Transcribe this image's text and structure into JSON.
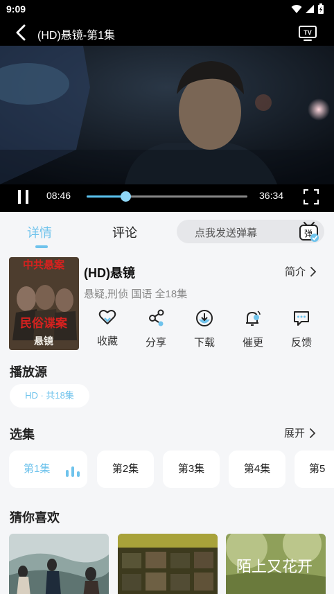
{
  "status": {
    "time": "9:09"
  },
  "header": {
    "title": "(HD)悬镜-第1集"
  },
  "player": {
    "current_time": "08:46",
    "total_time": "36:34",
    "progress_fraction": 0.24
  },
  "tabs": [
    {
      "label": "详情",
      "active": true
    },
    {
      "label": "评论",
      "active": false
    }
  ],
  "danmaku": {
    "placeholder": "点我发送弹幕",
    "icon_char": "弹"
  },
  "show": {
    "title": "(HD)悬镜",
    "meta": "悬疑,刑侦 国语 全18集",
    "intro_label": "简介",
    "poster_text": {
      "top": "中共悬案",
      "middle": "民俗谍案",
      "bottom": "悬镜"
    }
  },
  "actions": [
    {
      "label": "收藏",
      "icon": "heart-icon"
    },
    {
      "label": "分享",
      "icon": "share-icon"
    },
    {
      "label": "下载",
      "icon": "download-icon"
    },
    {
      "label": "催更",
      "icon": "bell-icon"
    },
    {
      "label": "反馈",
      "icon": "feedback-icon"
    }
  ],
  "source": {
    "title": "播放源",
    "chip": "HD · 共18集"
  },
  "episodes": {
    "title": "选集",
    "expand_label": "展开",
    "items": [
      "第1集",
      "第2集",
      "第3集",
      "第4集",
      "第5"
    ],
    "active_index": 0
  },
  "recommend": {
    "title": "猜你喜欢",
    "third_poster_text": "陌上又花开"
  },
  "colors": {
    "accent": "#6fc3ec",
    "background": "#f5f6f8"
  }
}
